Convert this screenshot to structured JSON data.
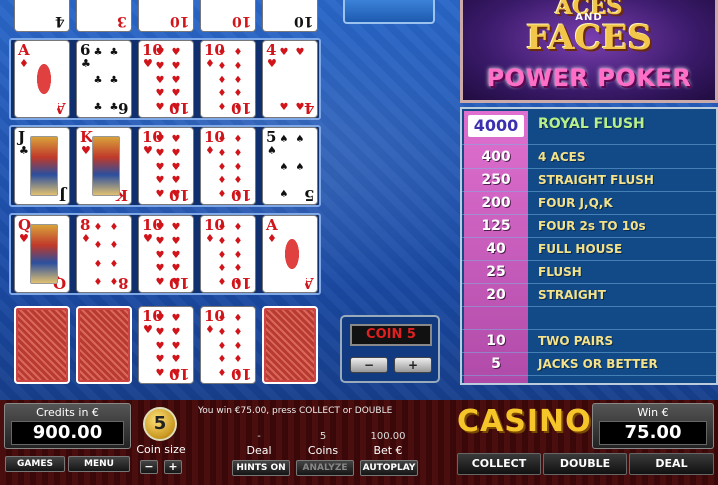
{
  "paytable": [
    {
      "value": "4000",
      "name": "ROYAL FLUSH"
    },
    {
      "value": "400",
      "name": "4 ACES"
    },
    {
      "value": "250",
      "name": "STRAIGHT FLUSH"
    },
    {
      "value": "200",
      "name": "FOUR J,Q,K"
    },
    {
      "value": "125",
      "name": "FOUR 2s TO 10s"
    },
    {
      "value": "40",
      "name": "FULL HOUSE"
    },
    {
      "value": "25",
      "name": "FLUSH"
    },
    {
      "value": "20",
      "name": "STRAIGHT"
    },
    {
      "value": "",
      "name": ""
    },
    {
      "value": "10",
      "name": "TWO PAIRS"
    },
    {
      "value": "5",
      "name": "JACKS OR BETTER"
    }
  ],
  "logo": {
    "line1": "ACES",
    "and": "AND",
    "line2": "FACES",
    "line3": "POWER POKER"
  },
  "coin_display": "COIN 5",
  "coin_minus": "−",
  "coin_plus": "+",
  "credits": {
    "label": "Credits in €",
    "value": "900.00"
  },
  "win": {
    "label": "Win €",
    "value": "75.00"
  },
  "coin_size": {
    "value": "5",
    "label": "Coin size",
    "minus": "−",
    "plus": "+"
  },
  "message": "You win €75.00, press COLLECT or DOUBLE",
  "stats": {
    "deal_value": "-",
    "deal_label": "Deal",
    "coins_value": "5",
    "coins_label": "Coins",
    "bet_value": "100.00",
    "bet_label": "Bet €"
  },
  "buttons": {
    "games": "GAMES",
    "menu": "MENU",
    "hints": "HINTS ON",
    "analyze": "ANALYZE",
    "autoplay": "AUTOPLAY",
    "collect": "COLLECT",
    "double": "DOUBLE",
    "deal": "DEAL"
  },
  "casino_logo": "CASINO",
  "top_stubs": [
    {
      "rank": "4",
      "color": "black"
    },
    {
      "rank": "3",
      "color": "red"
    },
    {
      "rank": "10",
      "color": "red"
    },
    {
      "rank": "10",
      "color": "red"
    },
    {
      "rank": "10",
      "color": "black"
    }
  ],
  "hands": [
    {
      "cards": [
        {
          "rank": "A",
          "suit": "♦",
          "color": "red",
          "type": "ace"
        },
        {
          "rank": "6",
          "suit": "♣",
          "color": "black",
          "type": "pips",
          "n": 6
        },
        {
          "rank": "10",
          "suit": "♥",
          "color": "red",
          "type": "pips",
          "n": 10
        },
        {
          "rank": "10",
          "suit": "♦",
          "color": "red",
          "type": "pips",
          "n": 10
        },
        {
          "rank": "4",
          "suit": "♥",
          "color": "red",
          "type": "pips",
          "n": 4
        }
      ]
    },
    {
      "cards": [
        {
          "rank": "J",
          "suit": "♣",
          "color": "black",
          "type": "face"
        },
        {
          "rank": "K",
          "suit": "♥",
          "color": "red",
          "type": "face"
        },
        {
          "rank": "10",
          "suit": "♥",
          "color": "red",
          "type": "pips",
          "n": 10
        },
        {
          "rank": "10",
          "suit": "♦",
          "color": "red",
          "type": "pips",
          "n": 10
        },
        {
          "rank": "5",
          "suit": "♠",
          "color": "black",
          "type": "pips",
          "n": 5
        }
      ]
    },
    {
      "cards": [
        {
          "rank": "Q",
          "suit": "♥",
          "color": "red",
          "type": "face"
        },
        {
          "rank": "8",
          "suit": "♦",
          "color": "red",
          "type": "pips",
          "n": 8
        },
        {
          "rank": "10",
          "suit": "♥",
          "color": "red",
          "type": "pips",
          "n": 10
        },
        {
          "rank": "10",
          "suit": "♦",
          "color": "red",
          "type": "pips",
          "n": 10
        },
        {
          "rank": "A",
          "suit": "♦",
          "color": "red",
          "type": "ace"
        }
      ]
    }
  ],
  "base_hand": [
    {
      "type": "back"
    },
    {
      "type": "back"
    },
    {
      "rank": "10",
      "suit": "♥",
      "color": "red",
      "type": "pips",
      "n": 10
    },
    {
      "rank": "10",
      "suit": "♦",
      "color": "red",
      "type": "pips",
      "n": 10
    },
    {
      "type": "back"
    }
  ]
}
